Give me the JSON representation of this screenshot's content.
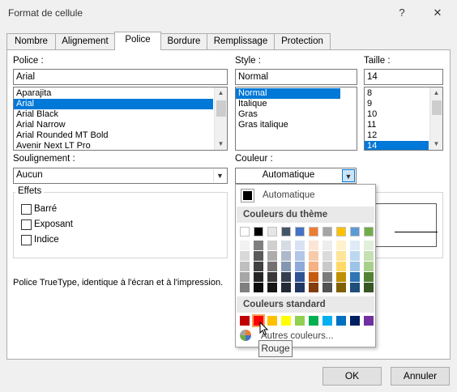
{
  "window": {
    "title": "Format de cellule",
    "help": "?",
    "close": "✕"
  },
  "tabs": [
    {
      "label": "Nombre"
    },
    {
      "label": "Alignement"
    },
    {
      "label": "Police",
      "active": true
    },
    {
      "label": "Bordure"
    },
    {
      "label": "Remplissage"
    },
    {
      "label": "Protection"
    }
  ],
  "font": {
    "label": "Police :",
    "value": "Arial",
    "items": [
      "Aparajita",
      "Arial",
      "Arial Black",
      "Arial Narrow",
      "Arial Rounded MT Bold",
      "Avenir Next LT Pro"
    ],
    "selected": "Arial"
  },
  "style": {
    "label": "Style :",
    "value": "Normal",
    "items": [
      "Normal",
      "Italique",
      "Gras",
      "Gras italique"
    ],
    "selected": "Normal"
  },
  "size": {
    "label": "Taille :",
    "value": "14",
    "items": [
      "8",
      "9",
      "10",
      "11",
      "12",
      "14"
    ],
    "selected": "14"
  },
  "underline": {
    "label": "Soulignement :",
    "value": "Aucun"
  },
  "color": {
    "label": "Couleur :",
    "value": "Automatique"
  },
  "effects": {
    "title": "Effets",
    "items": [
      {
        "label": "Barré",
        "checked": false
      },
      {
        "label": "Exposant",
        "checked": false
      },
      {
        "label": "Indice",
        "checked": false
      }
    ]
  },
  "info_text": "Police TrueType, identique à l'écran et à l'impression.",
  "color_picker": {
    "automatic_label": "Automatique",
    "automatic_color": "#000000",
    "theme_title": "Couleurs du thème",
    "theme_top": [
      "#ffffff",
      "#000000",
      "#e7e6e6",
      "#44546a",
      "#4472c4",
      "#ed7d31",
      "#a5a5a5",
      "#ffc000",
      "#5b9bd5",
      "#70ad47"
    ],
    "theme_shades": [
      [
        "#f2f2f2",
        "#d9d9d9",
        "#bfbfbf",
        "#a6a6a6",
        "#808080"
      ],
      [
        "#7f7f7f",
        "#595959",
        "#404040",
        "#262626",
        "#0d0d0d"
      ],
      [
        "#d0cece",
        "#aeabab",
        "#757171",
        "#3a3838",
        "#171616"
      ],
      [
        "#d6dce4",
        "#adb9ca",
        "#8497b0",
        "#333f4f",
        "#222a35"
      ],
      [
        "#d9e2f3",
        "#b4c6e7",
        "#8eaadb",
        "#2f5496",
        "#1f3864"
      ],
      [
        "#fbe5d5",
        "#f7cbac",
        "#f4b183",
        "#c55a11",
        "#833c0b"
      ],
      [
        "#ededed",
        "#dbdbdb",
        "#c9c9c9",
        "#7b7b7b",
        "#525252"
      ],
      [
        "#fff2cc",
        "#fee599",
        "#ffd966",
        "#bf9000",
        "#7f6000"
      ],
      [
        "#deebf6",
        "#bdd7ee",
        "#9dc3e6",
        "#2e75b5",
        "#1f4e79"
      ],
      [
        "#e2efd9",
        "#c5e0b3",
        "#a8d08d",
        "#538135",
        "#375623"
      ]
    ],
    "standard_title": "Couleurs standard",
    "standard": [
      "#c00000",
      "#ff0000",
      "#ffc000",
      "#ffff00",
      "#92d050",
      "#00b050",
      "#00b0f0",
      "#0070c0",
      "#002060",
      "#7030a0"
    ],
    "more_label": "Autres couleurs...",
    "hovered": "Rouge"
  },
  "buttons": {
    "ok": "OK",
    "cancel": "Annuler"
  }
}
